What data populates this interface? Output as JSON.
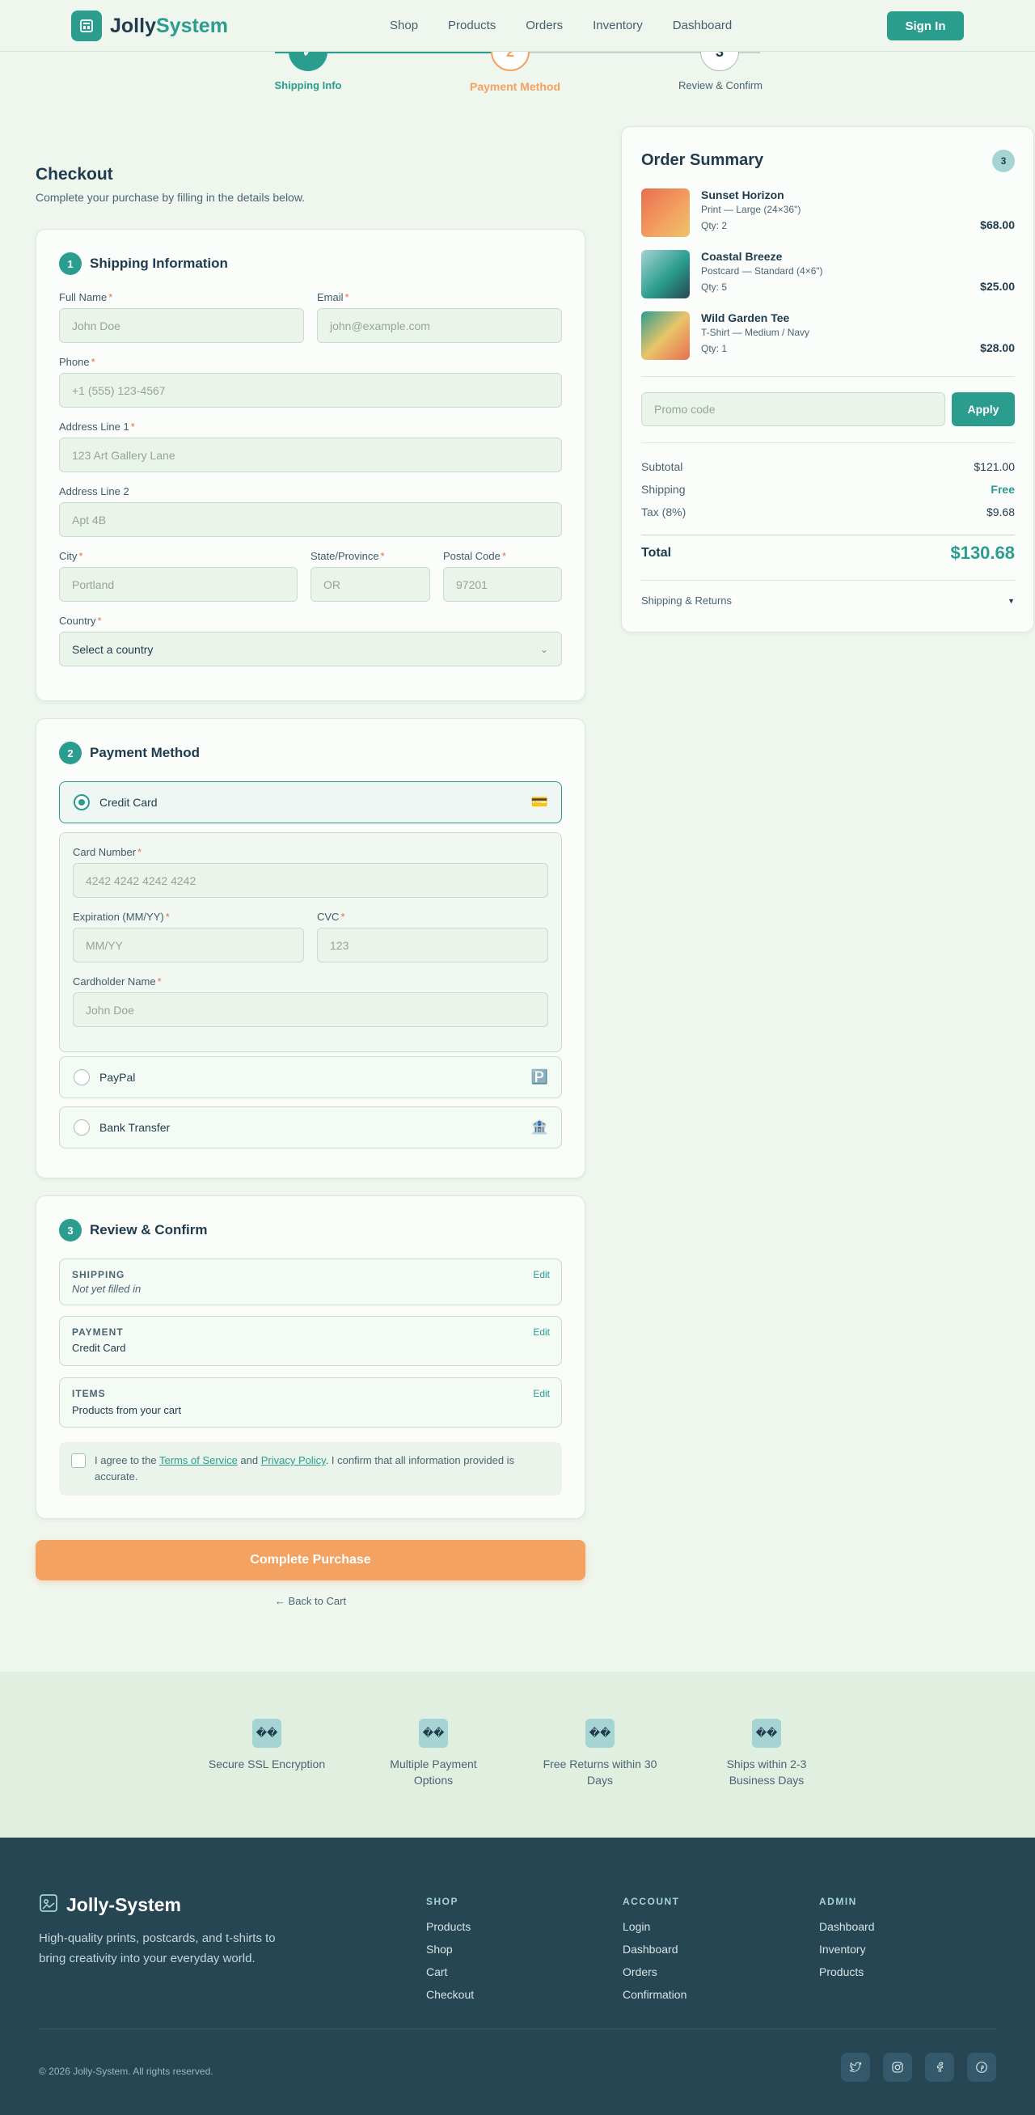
{
  "brand": {
    "name_part1": "Jolly",
    "name_part2": "System",
    "footer_name": "Jolly-System",
    "tagline": "High-quality prints, postcards, and t-shirts to bring creativity into your everyday world.",
    "accent_color": "#2a9d8f",
    "secondary_color": "#f4a261"
  },
  "nav": {
    "items": [
      "Shop",
      "Products",
      "Orders",
      "Inventory",
      "Dashboard"
    ],
    "signin": "Sign In"
  },
  "stepper": {
    "steps": [
      {
        "label": "Shipping Info",
        "state": "complete",
        "icon": "check-icon"
      },
      {
        "label": "Payment Method",
        "number": "2",
        "state": "active"
      },
      {
        "label": "Review & Confirm",
        "number": "3",
        "state": "upcoming"
      }
    ]
  },
  "checkout": {
    "title": "Checkout",
    "subtitle": "Complete your purchase by filling in the details below."
  },
  "shipping": {
    "number": "1",
    "title": "Shipping Information",
    "fields": {
      "full_name": {
        "label": "Full Name",
        "placeholder": "John Doe"
      },
      "email": {
        "label": "Email",
        "placeholder": "john@example.com"
      },
      "phone": {
        "label": "Phone",
        "placeholder": "+1 (555) 123-4567"
      },
      "address1": {
        "label": "Address Line 1",
        "placeholder": "123 Art Gallery Lane"
      },
      "address2": {
        "label": "Address Line 2",
        "placeholder": "Apt 4B"
      },
      "city": {
        "label": "City",
        "placeholder": "Portland"
      },
      "state": {
        "label": "State/Province",
        "placeholder": "OR"
      },
      "postal": {
        "label": "Postal Code",
        "placeholder": "97201"
      },
      "country": {
        "label": "Country",
        "value": "Select a country"
      }
    },
    "required_mark": "*"
  },
  "payment": {
    "number": "2",
    "title": "Payment Method",
    "options": [
      {
        "label": "Credit Card",
        "icon": "💳",
        "selected": true
      },
      {
        "label": "PayPal",
        "icon": "🅿️",
        "selected": false
      },
      {
        "label": "Bank Transfer",
        "icon": "🏦",
        "selected": false
      }
    ],
    "card": {
      "number": {
        "label": "Card Number",
        "placeholder": "4242 4242 4242 4242"
      },
      "expiry": {
        "label": "Expiration (MM/YY)",
        "placeholder": "MM/YY"
      },
      "cvc": {
        "label": "CVC",
        "placeholder": "123"
      },
      "holder": {
        "label": "Cardholder Name",
        "placeholder": "John Doe"
      }
    }
  },
  "review": {
    "number": "3",
    "title": "Review & Confirm",
    "edit_label": "Edit",
    "boxes": [
      {
        "title": "SHIPPING",
        "value": "Not yet filled in"
      },
      {
        "title": "PAYMENT",
        "value": "Credit Card"
      },
      {
        "title": "ITEMS",
        "value": "Products from your cart"
      }
    ],
    "agree_pre": "I agree to the ",
    "terms": "Terms of Service",
    "and": " and ",
    "privacy": "Privacy Policy",
    "agree_post": ". I confirm that all information provided is accurate."
  },
  "actions": {
    "complete": "Complete Purchase",
    "back": "← Back to Cart"
  },
  "summary": {
    "title": "Order Summary",
    "count": "3",
    "items": [
      {
        "name": "Sunset Horizon",
        "variant": "Print — Large (24×36\")",
        "qty": "Qty: 2",
        "price": "$68.00"
      },
      {
        "name": "Coastal Breeze",
        "variant": "Postcard — Standard (4×6\")",
        "qty": "Qty: 5",
        "price": "$25.00"
      },
      {
        "name": "Wild Garden Tee",
        "variant": "T-Shirt — Medium / Navy",
        "qty": "Qty: 1",
        "price": "$28.00"
      }
    ],
    "promo_placeholder": "Promo code",
    "apply": "Apply",
    "subtotal_label": "Subtotal",
    "subtotal": "$121.00",
    "shipping_label": "Shipping",
    "shipping": "Free",
    "tax_label": "Tax (8%)",
    "tax": "$9.68",
    "total_label": "Total",
    "total": "$130.68",
    "returns_label": "Shipping & Returns"
  },
  "features": [
    {
      "icon": "��",
      "text": "Secure SSL Encryption"
    },
    {
      "icon": "��",
      "text": "Multiple Payment Options"
    },
    {
      "icon": "��",
      "text": "Free Returns within 30 Days"
    },
    {
      "icon": "��",
      "text": "Ships within 2-3 Business Days"
    }
  ],
  "footer": {
    "columns": [
      {
        "heading": "SHOP",
        "links": [
          "Products",
          "Shop",
          "Cart",
          "Checkout"
        ]
      },
      {
        "heading": "ACCOUNT",
        "links": [
          "Login",
          "Dashboard",
          "Orders",
          "Confirmation"
        ]
      },
      {
        "heading": "ADMIN",
        "links": [
          "Dashboard",
          "Inventory",
          "Products"
        ]
      }
    ],
    "copyright": "© 2026 Jolly-System. All rights reserved.",
    "social": [
      "twitter-icon",
      "instagram-icon",
      "facebook-icon",
      "pinterest-icon"
    ]
  }
}
